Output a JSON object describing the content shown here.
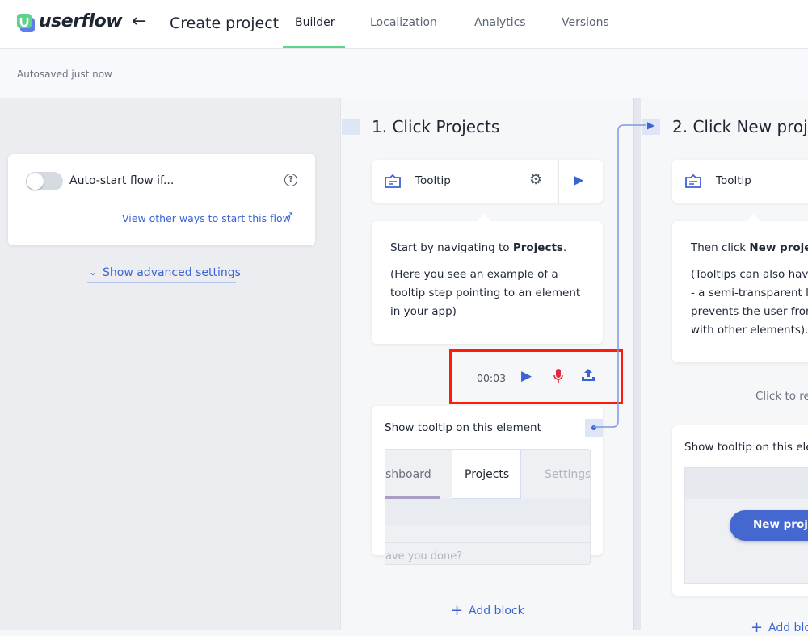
{
  "app": {
    "brand": "userflow",
    "page_title": "Create project",
    "tabs": [
      {
        "label": "Builder",
        "active": true
      },
      {
        "label": "Localization"
      },
      {
        "label": "Analytics"
      },
      {
        "label": "Versions"
      }
    ],
    "status": "Autosaved just now"
  },
  "settings": {
    "auto_start_label": "Auto-start flow if...",
    "auto_start_on": false,
    "other_ways_link": "View other ways to start this flow",
    "advanced_link": "Show advanced settings"
  },
  "steps": [
    {
      "number": "1.",
      "title": "Click Projects",
      "block_type": "Tooltip",
      "content_prefix": "Start by navigating to ",
      "content_bold": "Projects",
      "content_suffix": ".",
      "content_note": "(Here you see an example of a tooltip step pointing to an element in your app)",
      "note_lines": [
        "(Here you see an example of a",
        "tooltip step pointing to an element",
        "in your app)"
      ],
      "recording": {
        "time": "00:03"
      },
      "element_label": "Show tooltip on this element",
      "preview_tabs": [
        "shboard",
        "Projects",
        "Settings"
      ],
      "preview_placeholder": "ave you done?",
      "add_block": "Add block"
    },
    {
      "number": "2.",
      "title": "Click New proj",
      "block_type": "Tooltip",
      "content_prefix": "Then click ",
      "content_bold": "New projec",
      "note_lines": [
        "(Tooltips can also hav",
        "- a semi-transparent l",
        "prevents the user from",
        "with other elements)."
      ],
      "hint": "Click to re",
      "element_label": "Show tooltip on this ele",
      "preview_button": "New proje",
      "add_block": "Add blo"
    }
  ],
  "colors": {
    "accent": "#3b63d6",
    "tab_underline": "#5fd38a",
    "record": "#e0293e",
    "highlight": "#ff1a0a"
  }
}
